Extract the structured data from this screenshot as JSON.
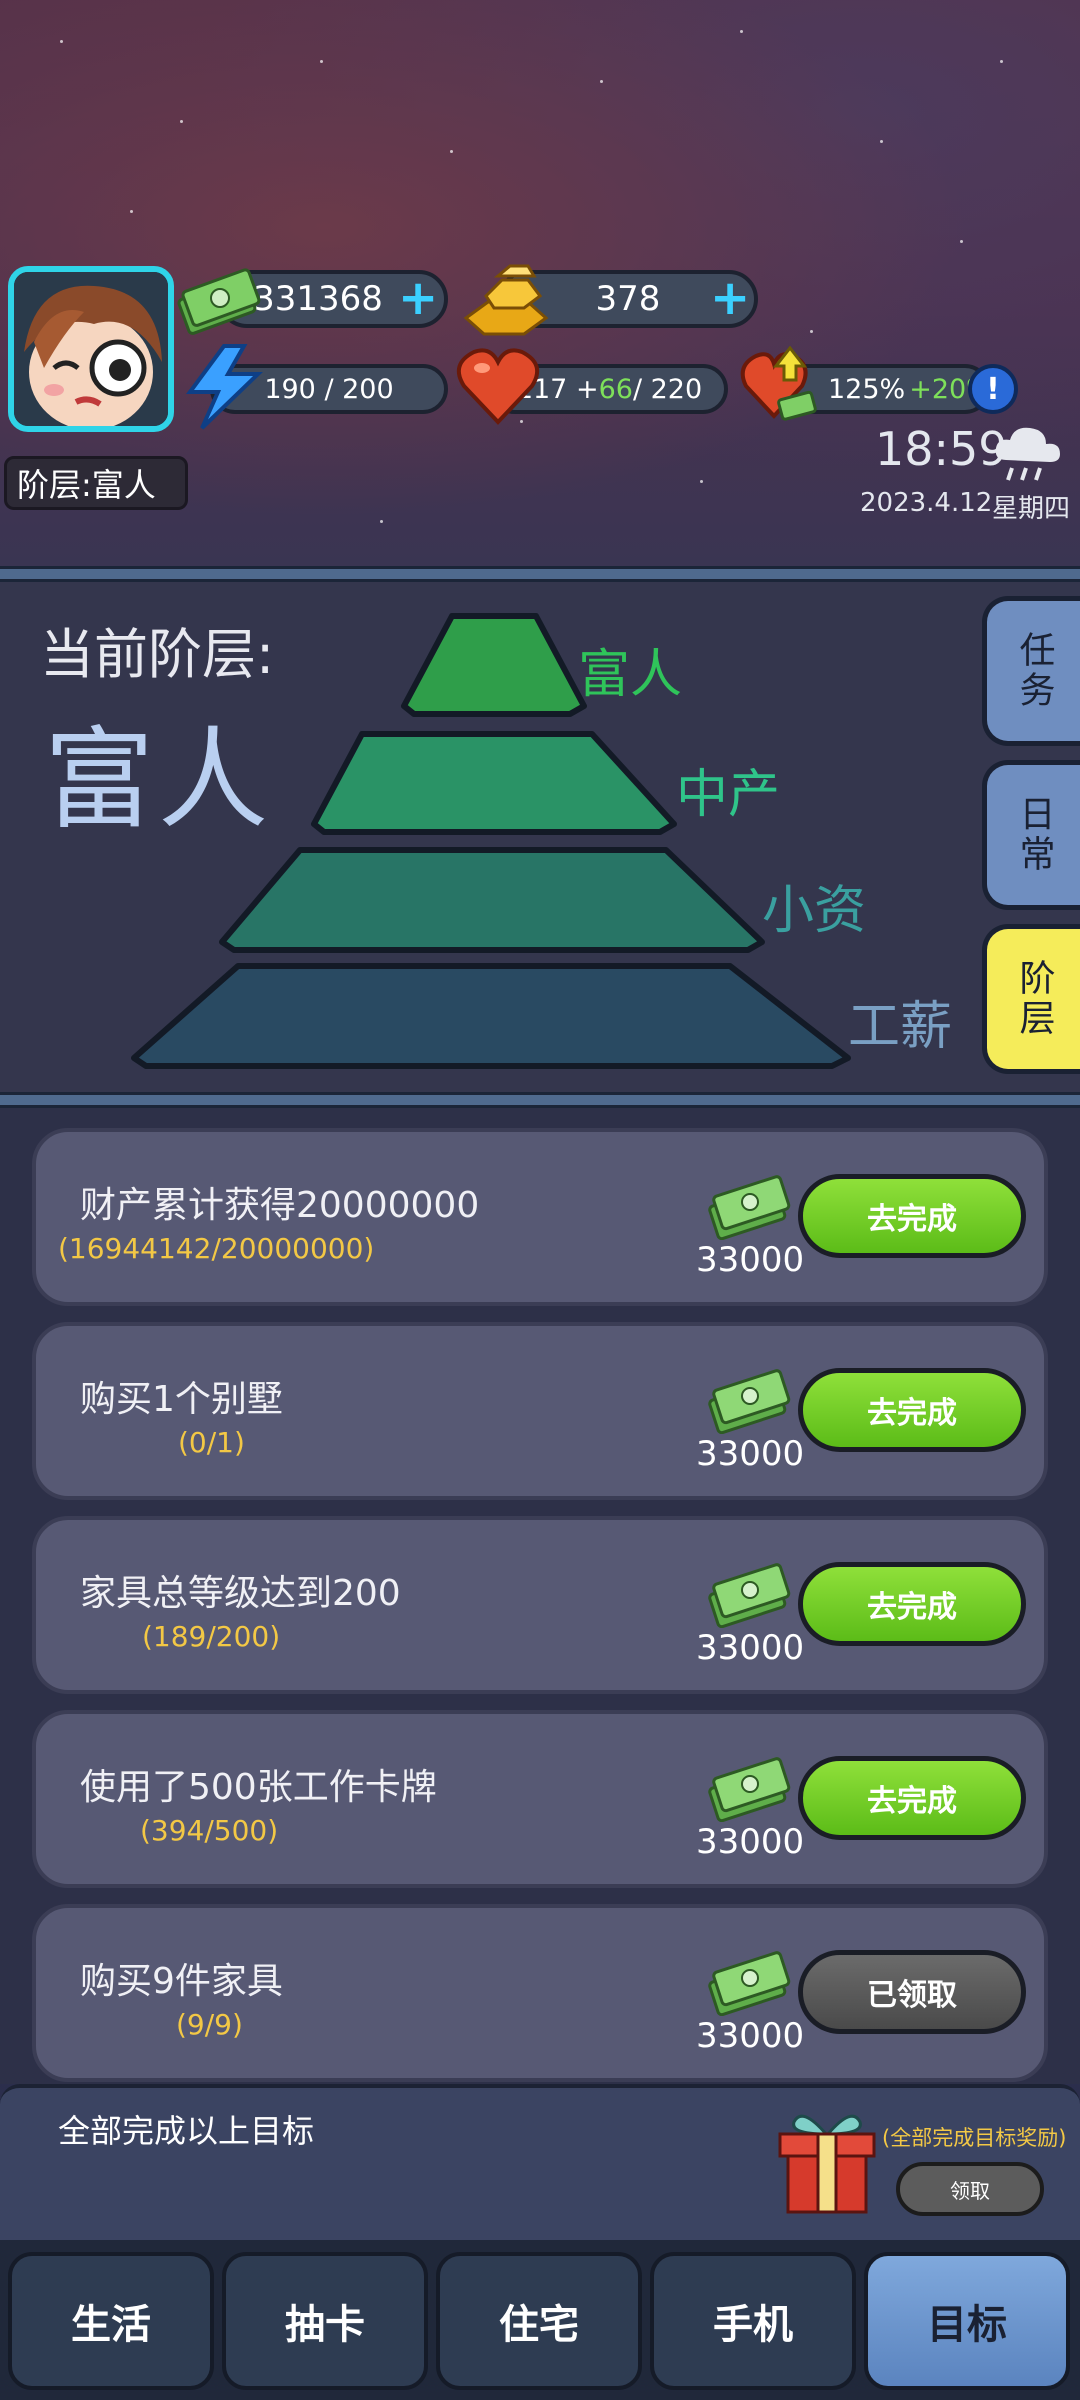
{
  "player": {
    "rank_badge": "阶层:富人"
  },
  "currencies": {
    "cash": "331368",
    "gold": "378",
    "energy": "190 / 200",
    "health_base": "117 + ",
    "health_bonus": "66",
    "health_max": " / 220",
    "income_base": "125%",
    "income_bonus": "+20%",
    "info_icon_label": "!"
  },
  "clock": {
    "time": "18:59",
    "date": "2023.4.12",
    "weekday": "星期四",
    "weather": "rain-cloud-icon"
  },
  "pyramid": {
    "current_label": "当前阶层:",
    "current_value": "富人",
    "tiers": [
      {
        "label": "富人",
        "color": "#2f9e4a"
      },
      {
        "label": "中产",
        "color": "#2a9366"
      },
      {
        "label": "小资",
        "color": "#287566"
      },
      {
        "label": "工薪",
        "color": "#294a62"
      }
    ]
  },
  "side_tabs": [
    {
      "label": "任务",
      "active": false
    },
    {
      "label": "日常",
      "active": false
    },
    {
      "label": "阶层",
      "active": true
    }
  ],
  "tasks": [
    {
      "title": "财产累计获得20000000",
      "progress": "(16944142/20000000)",
      "reward": "33000",
      "button": "去完成",
      "state": "go"
    },
    {
      "title": "购买1个别墅",
      "progress": "(0/1)",
      "reward": "33000",
      "button": "去完成",
      "state": "go"
    },
    {
      "title": "家具总等级达到200",
      "progress": "(189/200)",
      "reward": "33000",
      "button": "去完成",
      "state": "go"
    },
    {
      "title": "使用了500张工作卡牌",
      "progress": "(394/500)",
      "reward": "33000",
      "button": "去完成",
      "state": "go"
    },
    {
      "title": "购买9件家具",
      "progress": "(9/9)",
      "reward": "33000",
      "button": "已领取",
      "state": "done"
    }
  ],
  "summary": {
    "title": "全部完成以上目标",
    "note": "(全部完成目标奖励)",
    "button": "领取"
  },
  "nav": [
    {
      "label": "生活",
      "active": false
    },
    {
      "label": "抽卡",
      "active": false
    },
    {
      "label": "住宅",
      "active": false
    },
    {
      "label": "手机",
      "active": false
    },
    {
      "label": "目标",
      "active": true
    }
  ],
  "colors": {
    "accent_green": "#6cd020",
    "progress_yellow": "#f3c845",
    "avatar_border": "#2fd4e8"
  }
}
